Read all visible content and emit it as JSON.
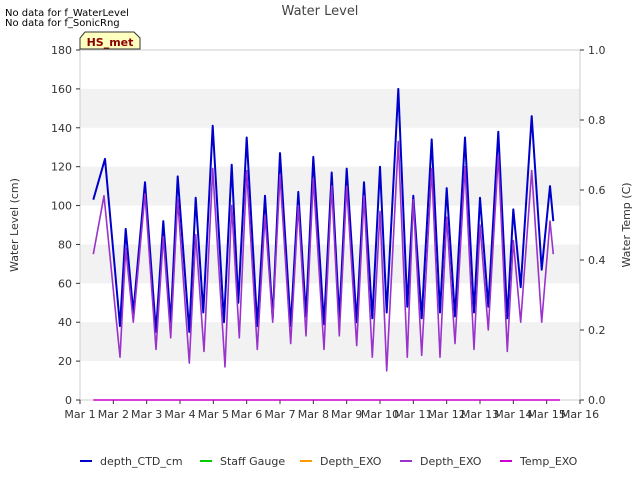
{
  "notes": [
    "No data for f_WaterLevel",
    "No data for f_SonicRng"
  ],
  "badge": "HS_met",
  "chart_data": {
    "type": "line",
    "title": "Water Level",
    "ylabel": "Water Level (cm)",
    "y2label": "Water Temp (C)",
    "ylim": [
      0,
      180
    ],
    "y2lim": [
      0,
      1.0
    ],
    "yticks": [
      0,
      20,
      40,
      60,
      80,
      100,
      120,
      140,
      160,
      180
    ],
    "y2ticks": [
      "0.0",
      "0.2",
      "0.4",
      "0.6",
      "0.8",
      "1.0"
    ],
    "xlim": [
      "Mar 1",
      "Mar 16"
    ],
    "xticks": [
      "Mar 1",
      "Mar 2",
      "Mar 3",
      "Mar 4",
      "Mar 5",
      "Mar 6",
      "Mar 7",
      "Mar 8",
      "Mar 9",
      "Mar 10",
      "Mar 11",
      "Mar 12",
      "Mar 13",
      "Mar 14",
      "Mar 15",
      "Mar 16"
    ],
    "grid": "horizontal bands",
    "legend_position": "bottom",
    "series": [
      {
        "name": "depth_CTD_cm",
        "color": "#0000cc",
        "x_start": "Mar 1.4",
        "x_end": "Mar 15.4",
        "peaks": [
          {
            "x": 1.75,
            "y": 124
          },
          {
            "x": 2.2,
            "y": 38
          },
          {
            "x": 2.37,
            "y": 88
          },
          {
            "x": 2.6,
            "y": 45
          },
          {
            "x": 2.95,
            "y": 112
          },
          {
            "x": 3.28,
            "y": 35
          },
          {
            "x": 3.5,
            "y": 92
          },
          {
            "x": 3.72,
            "y": 40
          },
          {
            "x": 3.93,
            "y": 115
          },
          {
            "x": 4.28,
            "y": 35
          },
          {
            "x": 4.47,
            "y": 104
          },
          {
            "x": 4.7,
            "y": 45
          },
          {
            "x": 4.98,
            "y": 141
          },
          {
            "x": 5.32,
            "y": 40
          },
          {
            "x": 5.55,
            "y": 121
          },
          {
            "x": 5.75,
            "y": 50
          },
          {
            "x": 6.0,
            "y": 135
          },
          {
            "x": 6.32,
            "y": 38
          },
          {
            "x": 6.55,
            "y": 105
          },
          {
            "x": 6.78,
            "y": 42
          },
          {
            "x": 7.0,
            "y": 127
          },
          {
            "x": 7.32,
            "y": 38
          },
          {
            "x": 7.55,
            "y": 107
          },
          {
            "x": 7.78,
            "y": 43
          },
          {
            "x": 8.0,
            "y": 125
          },
          {
            "x": 8.32,
            "y": 39
          },
          {
            "x": 8.55,
            "y": 117
          },
          {
            "x": 8.78,
            "y": 42
          },
          {
            "x": 9.0,
            "y": 119
          },
          {
            "x": 9.3,
            "y": 40
          },
          {
            "x": 9.52,
            "y": 112
          },
          {
            "x": 9.77,
            "y": 42
          },
          {
            "x": 10.0,
            "y": 120
          },
          {
            "x": 10.2,
            "y": 45
          },
          {
            "x": 10.55,
            "y": 160
          },
          {
            "x": 10.82,
            "y": 48
          },
          {
            "x": 11.0,
            "y": 105
          },
          {
            "x": 11.25,
            "y": 42
          },
          {
            "x": 11.55,
            "y": 134
          },
          {
            "x": 11.8,
            "y": 45
          },
          {
            "x": 12.0,
            "y": 109
          },
          {
            "x": 12.25,
            "y": 43
          },
          {
            "x": 12.55,
            "y": 135
          },
          {
            "x": 12.82,
            "y": 45
          },
          {
            "x": 13.0,
            "y": 104
          },
          {
            "x": 13.25,
            "y": 48
          },
          {
            "x": 13.55,
            "y": 138
          },
          {
            "x": 13.82,
            "y": 42
          },
          {
            "x": 14.0,
            "y": 98
          },
          {
            "x": 14.22,
            "y": 58
          },
          {
            "x": 14.55,
            "y": 146
          },
          {
            "x": 14.85,
            "y": 67
          },
          {
            "x": 15.1,
            "y": 110
          },
          {
            "x": 15.2,
            "y": 92
          }
        ]
      },
      {
        "name": "Staff Gauge",
        "color": "#00cc00"
      },
      {
        "name": "Depth_EXO",
        "color": "#ff9900"
      },
      {
        "name": "Depth_EXO",
        "color": "#9933cc",
        "x_start": "Mar 1.4",
        "x_end": "Mar 15.4",
        "peaks": [
          {
            "x": 1.72,
            "y": 105
          },
          {
            "x": 2.2,
            "y": 22
          },
          {
            "x": 2.37,
            "y": 78
          },
          {
            "x": 2.6,
            "y": 40
          },
          {
            "x": 2.95,
            "y": 106
          },
          {
            "x": 3.28,
            "y": 26
          },
          {
            "x": 3.5,
            "y": 84
          },
          {
            "x": 3.72,
            "y": 32
          },
          {
            "x": 3.93,
            "y": 103
          },
          {
            "x": 4.28,
            "y": 19
          },
          {
            "x": 4.47,
            "y": 85
          },
          {
            "x": 4.72,
            "y": 25
          },
          {
            "x": 4.98,
            "y": 119
          },
          {
            "x": 5.35,
            "y": 17
          },
          {
            "x": 5.55,
            "y": 100
          },
          {
            "x": 5.78,
            "y": 32
          },
          {
            "x": 6.0,
            "y": 118
          },
          {
            "x": 6.32,
            "y": 26
          },
          {
            "x": 6.55,
            "y": 95
          },
          {
            "x": 6.78,
            "y": 40
          },
          {
            "x": 7.0,
            "y": 116
          },
          {
            "x": 7.32,
            "y": 29
          },
          {
            "x": 7.55,
            "y": 100
          },
          {
            "x": 7.78,
            "y": 33
          },
          {
            "x": 8.0,
            "y": 114
          },
          {
            "x": 8.32,
            "y": 26
          },
          {
            "x": 8.55,
            "y": 110
          },
          {
            "x": 8.78,
            "y": 33
          },
          {
            "x": 9.0,
            "y": 110
          },
          {
            "x": 9.3,
            "y": 28
          },
          {
            "x": 9.52,
            "y": 105
          },
          {
            "x": 9.77,
            "y": 22
          },
          {
            "x": 10.0,
            "y": 97
          },
          {
            "x": 10.2,
            "y": 15
          },
          {
            "x": 10.55,
            "y": 133
          },
          {
            "x": 10.82,
            "y": 22
          },
          {
            "x": 11.0,
            "y": 103
          },
          {
            "x": 11.25,
            "y": 23
          },
          {
            "x": 11.55,
            "y": 119
          },
          {
            "x": 11.8,
            "y": 22
          },
          {
            "x": 12.0,
            "y": 94
          },
          {
            "x": 12.25,
            "y": 29
          },
          {
            "x": 12.55,
            "y": 120
          },
          {
            "x": 12.82,
            "y": 26
          },
          {
            "x": 13.0,
            "y": 90
          },
          {
            "x": 13.25,
            "y": 36
          },
          {
            "x": 13.55,
            "y": 126
          },
          {
            "x": 13.82,
            "y": 25
          },
          {
            "x": 14.0,
            "y": 82
          },
          {
            "x": 14.22,
            "y": 40
          },
          {
            "x": 14.55,
            "y": 118
          },
          {
            "x": 14.85,
            "y": 40
          },
          {
            "x": 15.1,
            "y": 92
          },
          {
            "x": 15.2,
            "y": 75
          }
        ]
      },
      {
        "name": "Temp_EXO",
        "color": "#cc00cc",
        "x_start": "Mar 1.4",
        "x_end": "Mar 15.4",
        "constant_y": 0
      }
    ]
  }
}
